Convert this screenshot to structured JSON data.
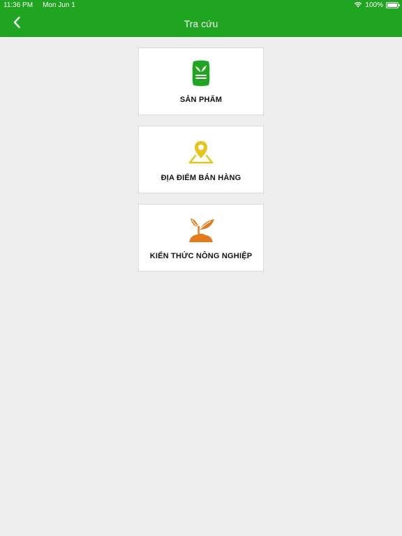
{
  "status_bar": {
    "time": "11:36 PM",
    "date": "Mon Jun 1",
    "battery": "100%",
    "icons": [
      "wifi-icon",
      "battery-icon"
    ]
  },
  "nav": {
    "title": "Tra cứu",
    "back_icon": "chevron-left-icon"
  },
  "colors": {
    "header": "#1fa51f",
    "background": "#eeeeee",
    "product_icon": "#1fa51f",
    "location_icon": "#e6c41a",
    "knowledge_icon": "#e37b1c"
  },
  "menu": [
    {
      "label": "SẢN PHẨM",
      "icon": "product-bag-icon"
    },
    {
      "label": "ĐỊA ĐIỂM BÁN HÀNG",
      "icon": "map-location-icon"
    },
    {
      "label": "KIẾN THỨC NÔNG NGHIỆP",
      "icon": "plant-sprout-icon"
    }
  ]
}
